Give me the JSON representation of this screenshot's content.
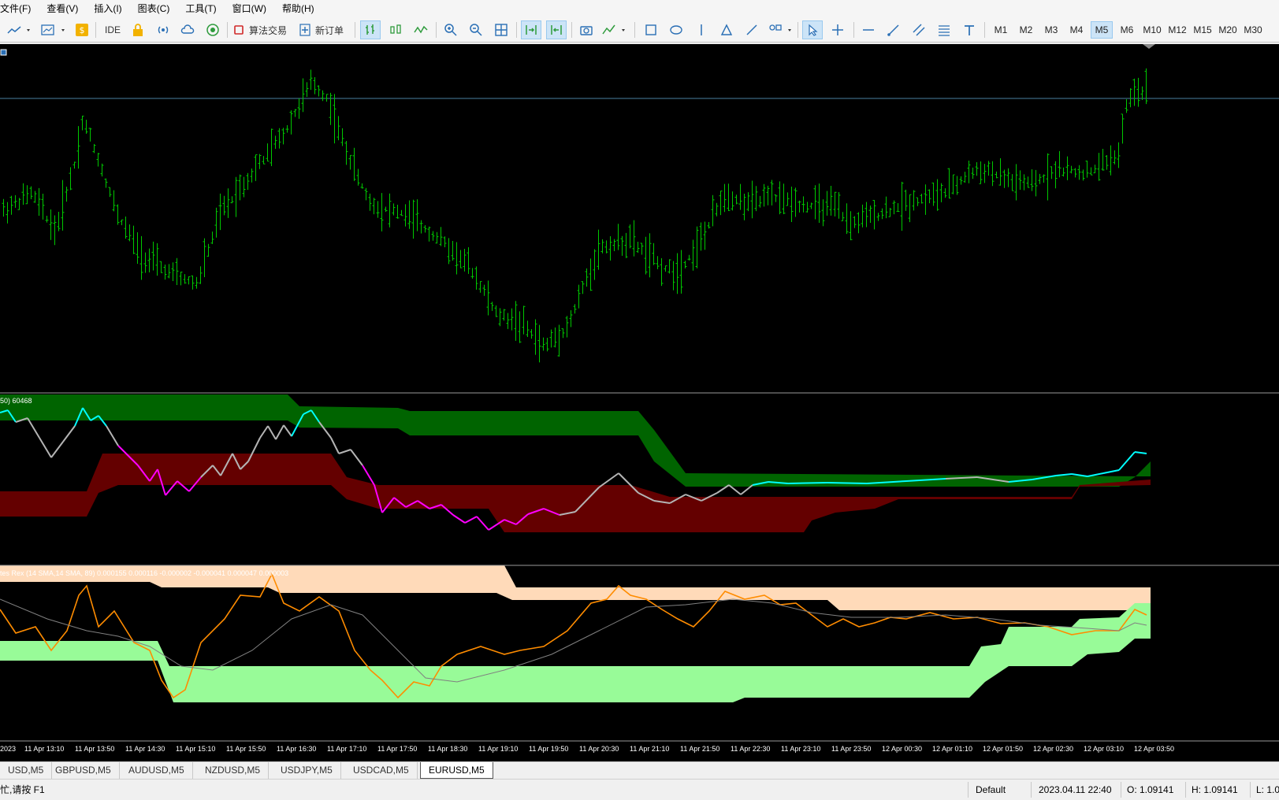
{
  "menu": [
    "文件(F)",
    "查看(V)",
    "插入(I)",
    "图表(C)",
    "工具(T)",
    "窗口(W)",
    "帮助(H)"
  ],
  "toolbar": {
    "ide_label": "IDE",
    "algo_trading_label": "算法交易",
    "new_order_label": "新订单",
    "timeframes": [
      "M1",
      "M2",
      "M3",
      "M4",
      "M5",
      "M6",
      "M10",
      "M12",
      "M15",
      "M20",
      "M30"
    ],
    "active_timeframe": "M5"
  },
  "indicator1_label": "50) 60468",
  "indicator2_label": "tes Rex (14 SMA,14 SMA, 89) 0.000155 0.000116 -0.000002 -0.000041 0.000047 0.000003",
  "time_axis": [
    "2023",
    "11 Apr 13:10",
    "11 Apr 13:50",
    "11 Apr 14:30",
    "11 Apr 15:10",
    "11 Apr 15:50",
    "11 Apr 16:30",
    "11 Apr 17:10",
    "11 Apr 17:50",
    "11 Apr 18:30",
    "11 Apr 19:10",
    "11 Apr 19:50",
    "11 Apr 20:30",
    "11 Apr 21:10",
    "11 Apr 21:50",
    "11 Apr 22:30",
    "11 Apr 23:10",
    "11 Apr 23:50",
    "12 Apr 00:30",
    "12 Apr 01:10",
    "12 Apr 01:50",
    "12 Apr 02:30",
    "12 Apr 03:10",
    "12 Apr 03:50"
  ],
  "tabs": [
    "USD,M5",
    "GBPUSD,M5",
    "AUDUSD,M5",
    "NZDUSD,M5",
    "USDJPY,M5",
    "USDCAD,M5",
    "EURUSD,M5"
  ],
  "active_tab": "EURUSD,M5",
  "status": {
    "help": "忙,请按 F1",
    "profile": "Default",
    "datetime": "2023.04.11 22:40",
    "open": "O: 1.09141",
    "high": "H: 1.09141",
    "low": "L: 1.0"
  },
  "colors": {
    "bars": "#00c800",
    "price_line": "#4a7fa0",
    "upper_band": "#006400",
    "lower_band": "#640000",
    "line_up": "#00ffff",
    "line_down": "#ff00ff",
    "line_neutral": "#b4b4b4",
    "peach_band": "#ffdab9",
    "green_band": "#98fb98",
    "osc_line": "#ff8c00",
    "osc_signal": "#808080"
  }
}
